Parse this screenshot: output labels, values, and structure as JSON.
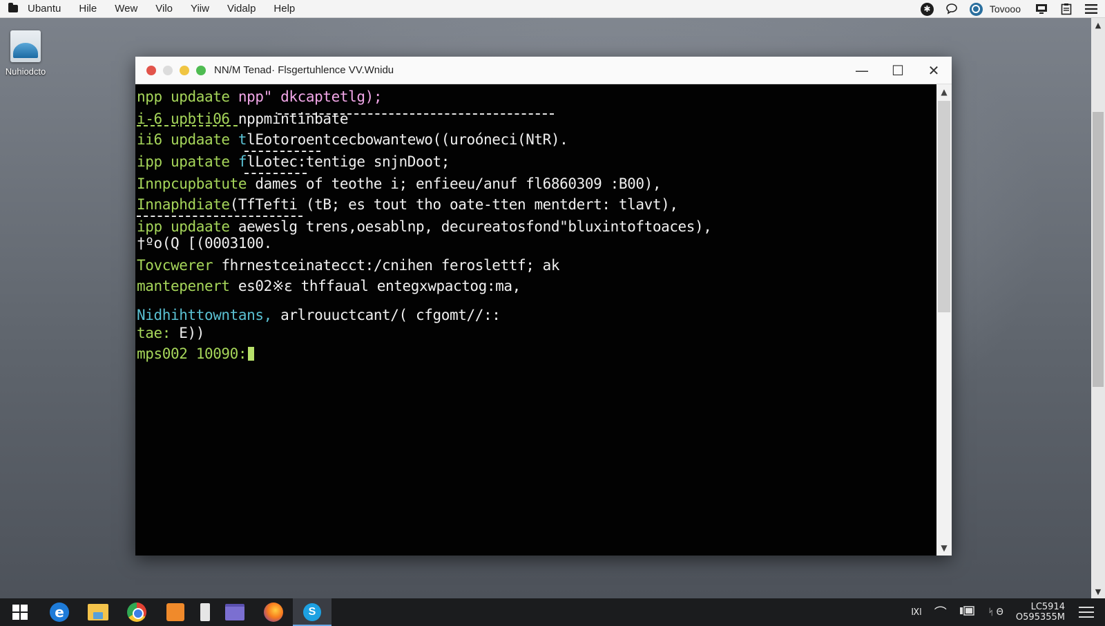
{
  "menubar": {
    "items": [
      "Ubantu",
      "Hile",
      "Wew",
      "Vilo",
      "Yiiw",
      "Vidalp",
      "Help"
    ],
    "user_name": "Tovooo"
  },
  "desktop": {
    "icon_label": "Nuhiodcto"
  },
  "window": {
    "title": "NN/M Tenad· Flsgertuhlence VV.Wnidu",
    "controls": {
      "minimize": "—",
      "maximize": "☐",
      "close": "✕"
    }
  },
  "terminal": {
    "lines": [
      {
        "a": "npp updaate ",
        "b": "npp\" ",
        "c": "dkcaptetlg);"
      },
      {
        "a": "i-6 upbti06 ",
        "b": "",
        "c": "nppmintinbate"
      },
      {
        "a": "ii6 updaate ",
        "b": "t",
        "c": "lEotoroentcecbowantewo((uroóneci(NtR)."
      },
      {
        "a": "ipp upatate ",
        "b": "f",
        "c": "lLotec:tentige snjnDoot;"
      },
      {
        "a": "Innpcupbatute ",
        "b": "",
        "c": "dames of teothe i; enfieeu/anuf fl6860309 :B00),"
      },
      {
        "a": "Innaphdiate",
        "b": "",
        "c": "(TfTefti (tB; es tout tho oate-tten mentdert: tlavt),"
      },
      {
        "a": "ipp updaate ",
        "b": "",
        "c": "aeweslg trens,oesablnp, decureatosfond\"bluxintoftoaces),"
      },
      {
        "a": "",
        "b": "",
        "c": "†ºo(Q [(0003100."
      },
      {
        "a": "Tovcwerer ",
        "b": "",
        "c": "fhrnestceinatecct:/cnihen feroslettf; ak"
      },
      {
        "a": "mantepenert ",
        "b": "",
        "c": "es02※ε thffaual entegxwpactog:ma,"
      },
      {
        "a": "",
        "b": "",
        "c": ""
      },
      {
        "a": "Nidhihttowntans, ",
        "b": "",
        "c": "arlrouuctcant/( cfgomt//::"
      },
      {
        "a": "tae: ",
        "b": "",
        "c": "E))"
      },
      {
        "a": "mps002 10090:",
        "b": "",
        "c": ""
      }
    ]
  },
  "taskbar": {
    "tray_text": "Ⅸl",
    "lang": "ᛋ Θ",
    "time": "LC5914",
    "date": "O595355M",
    "apps": [
      "start",
      "edge",
      "file-explorer",
      "chrome",
      "orange-app",
      "document",
      "purple-app",
      "firefox",
      "skype"
    ]
  },
  "colors": {
    "terminal_green": "#a6d65a",
    "terminal_pink": "#f2a7e8",
    "terminal_cyan": "#5ac0d2",
    "taskbar_bg": "#1b1c1e"
  }
}
